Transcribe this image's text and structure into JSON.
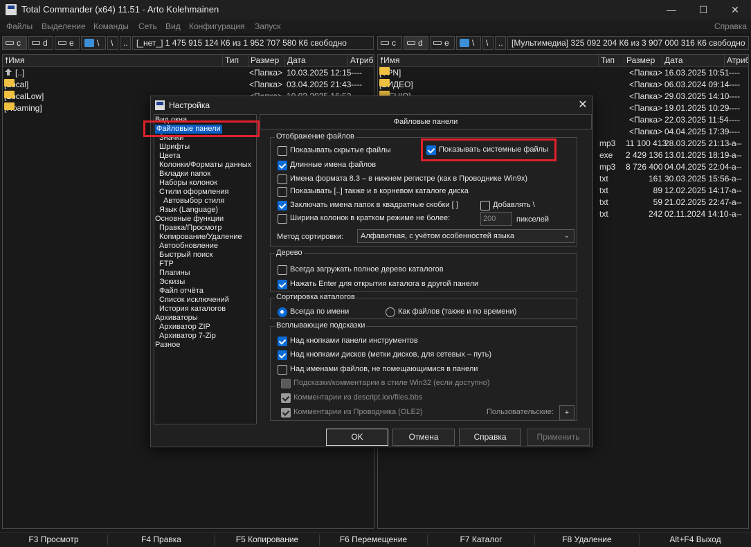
{
  "window": {
    "title": "Total Commander (x64) 11.51 - Arto Kolehmainen",
    "minimize": "—",
    "maximize": "☐",
    "close": "✕"
  },
  "menu": {
    "items": [
      "Файлы",
      "Выделение",
      "Команды",
      "Сеть",
      "Вид",
      "Конфигурация",
      "Запуск"
    ],
    "help": "Справка"
  },
  "left_drives": {
    "c": "c",
    "d": "d",
    "e": "e",
    "net": "\\",
    "root": "\\",
    "up": "..",
    "info": "[_нет_]  1 475 915 124 К6 из 1 952 707 580 К6 свободно"
  },
  "right_drives": {
    "c": "c",
    "d": "d",
    "e": "e",
    "net": "\\",
    "root": "\\",
    "up": "..",
    "info": "[Мультимедиа]  325 092 204 К6 из 3 907 000 316 К6 свободно"
  },
  "left_panel": {
    "headers": {
      "name": "Имя",
      "type": "Тип",
      "size": "Размер",
      "date": "Дата",
      "attr": "Атриб"
    },
    "rows": [
      {
        "name": "[..]",
        "size": "<Папка>",
        "date": "10.03.2025 12:15",
        "attr": "----"
      },
      {
        "name": "[Local]",
        "size": "<Папка>",
        "date": "03.04.2025 21:43",
        "attr": "----"
      },
      {
        "name": "[LocalLow]",
        "size": "<Папка>",
        "date": "10.03.2025 16:52",
        "attr": "----"
      },
      {
        "name": "[Roaming]",
        "size": "",
        "date": "",
        "attr": ""
      }
    ]
  },
  "right_panel": {
    "headers": {
      "name": "Имя",
      "type": "Тип",
      "size": "Размер",
      "date": "Дата",
      "attr": "Атриб"
    },
    "rows": [
      {
        "name": "[VPN]",
        "type": "",
        "size": "<Папка>",
        "date": "16.03.2025 10:51",
        "attr": "----"
      },
      {
        "name": "[ВИДЕО]",
        "type": "",
        "size": "<Папка>",
        "date": "06.03.2024 09:14",
        "attr": "----"
      },
      {
        "name": "[МЕНЮ]",
        "type": "",
        "size": "<Папка>",
        "date": "29.03.2025 14:10",
        "attr": "----"
      },
      {
        "name": "",
        "type": "",
        "size": "<Папка>",
        "date": "19.01.2025 10:29",
        "attr": "----"
      },
      {
        "name": "",
        "type": "",
        "size": "<Папка>",
        "date": "22.03.2025 11:54",
        "attr": "----"
      },
      {
        "name": "",
        "type": "",
        "size": "<Папка>",
        "date": "04.04.2025 17:39",
        "attr": "----"
      },
      {
        "name": "",
        "type": "mp3",
        "size": "11 100 413",
        "date": "28.03.2025 21:13",
        "attr": "-a--"
      },
      {
        "name": "",
        "type": "exe",
        "size": "2 429 136",
        "date": "13.01.2025 18:19",
        "attr": "-a--"
      },
      {
        "name": "",
        "type": "mp3",
        "size": "8 726 400",
        "date": "04.04.2025 22:04",
        "attr": "-a--"
      },
      {
        "name": "",
        "type": "txt",
        "size": "161",
        "date": "30.03.2025 15:56",
        "attr": "-a--"
      },
      {
        "name": "",
        "type": "txt",
        "size": "89",
        "date": "12.02.2025 14:17",
        "attr": "-a--"
      },
      {
        "name": "",
        "type": "txt",
        "size": "59",
        "date": "21.02.2025 22:47",
        "attr": "-a--"
      },
      {
        "name": "",
        "type": "txt",
        "size": "242",
        "date": "02.11.2024 14:10",
        "attr": "-a--"
      }
    ]
  },
  "fkeys": [
    "F3 Просмотр",
    "F4 Правка",
    "F5 Копирование",
    "F6 Перемещение",
    "F7 Каталог",
    "F8 Удаление",
    "Alt+F4 Выход"
  ],
  "dialog": {
    "title": "Настройка",
    "close": "✕",
    "tree": [
      "Вид окна",
      "Файловые панели",
      "Значки",
      "Шрифты",
      "Цвета",
      "Колонки/Форматы данных",
      "Вкладки папок",
      "Наборы колонок",
      "Стили оформления",
      "Автовыбор стиля",
      "Язык (Language)",
      "Основные функции",
      "Правка/Просмотр",
      "Копирование/Удаление",
      "Автообновление",
      "Быстрый поиск",
      "FTP",
      "Плагины",
      "Эскизы",
      "Файл отчёта",
      "Список исключений",
      "История каталогов",
      "Архиваторы",
      "Архиватор ZIP",
      "Архиватор 7-Zip",
      "Разное"
    ],
    "section_title": "Файловые панели",
    "display": {
      "label": "Отображение файлов",
      "hidden_files": "Показывать скрытые файлы",
      "system_files": "Показывать системные файлы",
      "long_names": "Длинные имена файлов",
      "lowercase_83": "Имена формата 8.3 – в нижнем регистре (как в Проводнике Win9x)",
      "show_dotdot": "Показывать [..] также и в корневом каталоге диска",
      "brackets": "Заключать имена папок в квадратные скобки [ ]",
      "add_backslash": "Добавлять \\",
      "col_width": "Ширина колонок в кратком режиме не более:",
      "col_width_value": "200",
      "pixels": "пикселей",
      "sort_method_label": "Метод сортировки:",
      "sort_method_value": "Алфавитная, с учётом особенностей языка"
    },
    "tree_group": {
      "label": "Дерево",
      "load_full_tree": "Всегда загружать полное дерево каталогов",
      "enter_other_panel": "Нажать Enter для открытия каталога в другой панели"
    },
    "dir_sort": {
      "label": "Сортировка каталогов",
      "by_name": "Всегда по имени",
      "like_files": "Как файлов (также и по времени)"
    },
    "tooltips": {
      "label": "Всплывающие подсказки",
      "toolbar_buttons": "Над кнопками панели инструментов",
      "drive_buttons": "Над кнопками дисков (метки дисков, для сетевых – путь)",
      "filenames": "Над именами файлов, не помещающимися в панели",
      "win32_style": "Подсказки/комментарии в стиле Win32 (если доступно)",
      "descript_ion": "Комментарии из descript.ion/files.bbs",
      "explorer_ole2": "Комментарии из Проводника (OLE2)",
      "custom": "Пользовательские:",
      "custom_btn": "+"
    },
    "buttons": {
      "ok": "OK",
      "cancel": "Отмена",
      "help": "Справка",
      "apply": "Применить"
    }
  }
}
